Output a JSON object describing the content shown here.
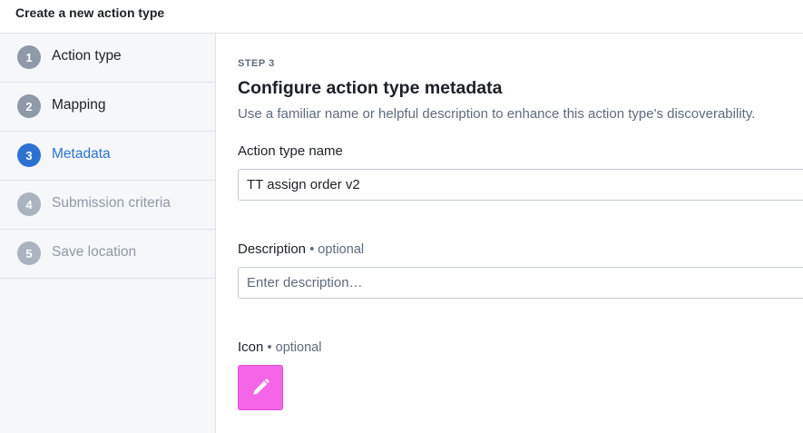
{
  "header": {
    "title": "Create a new action type"
  },
  "steps": [
    {
      "number": "1",
      "label": "Action type",
      "state": "done"
    },
    {
      "number": "2",
      "label": "Mapping",
      "state": "done"
    },
    {
      "number": "3",
      "label": "Metadata",
      "state": "active"
    },
    {
      "number": "4",
      "label": "Submission criteria",
      "state": "disabled"
    },
    {
      "number": "5",
      "label": "Save location",
      "state": "disabled"
    }
  ],
  "main": {
    "step_kicker": "STEP 3",
    "title": "Configure action type metadata",
    "description": "Use a familiar name or helpful description to enhance this action type's discoverability.",
    "name_field": {
      "label": "Action type name",
      "value": "TT assign order v2"
    },
    "description_field": {
      "label": "Description",
      "optional": "• optional",
      "value": "",
      "placeholder": "Enter description…"
    },
    "icon_field": {
      "label": "Icon",
      "optional": "• optional",
      "icon": "pencil-icon",
      "color": "#f565e8"
    }
  }
}
